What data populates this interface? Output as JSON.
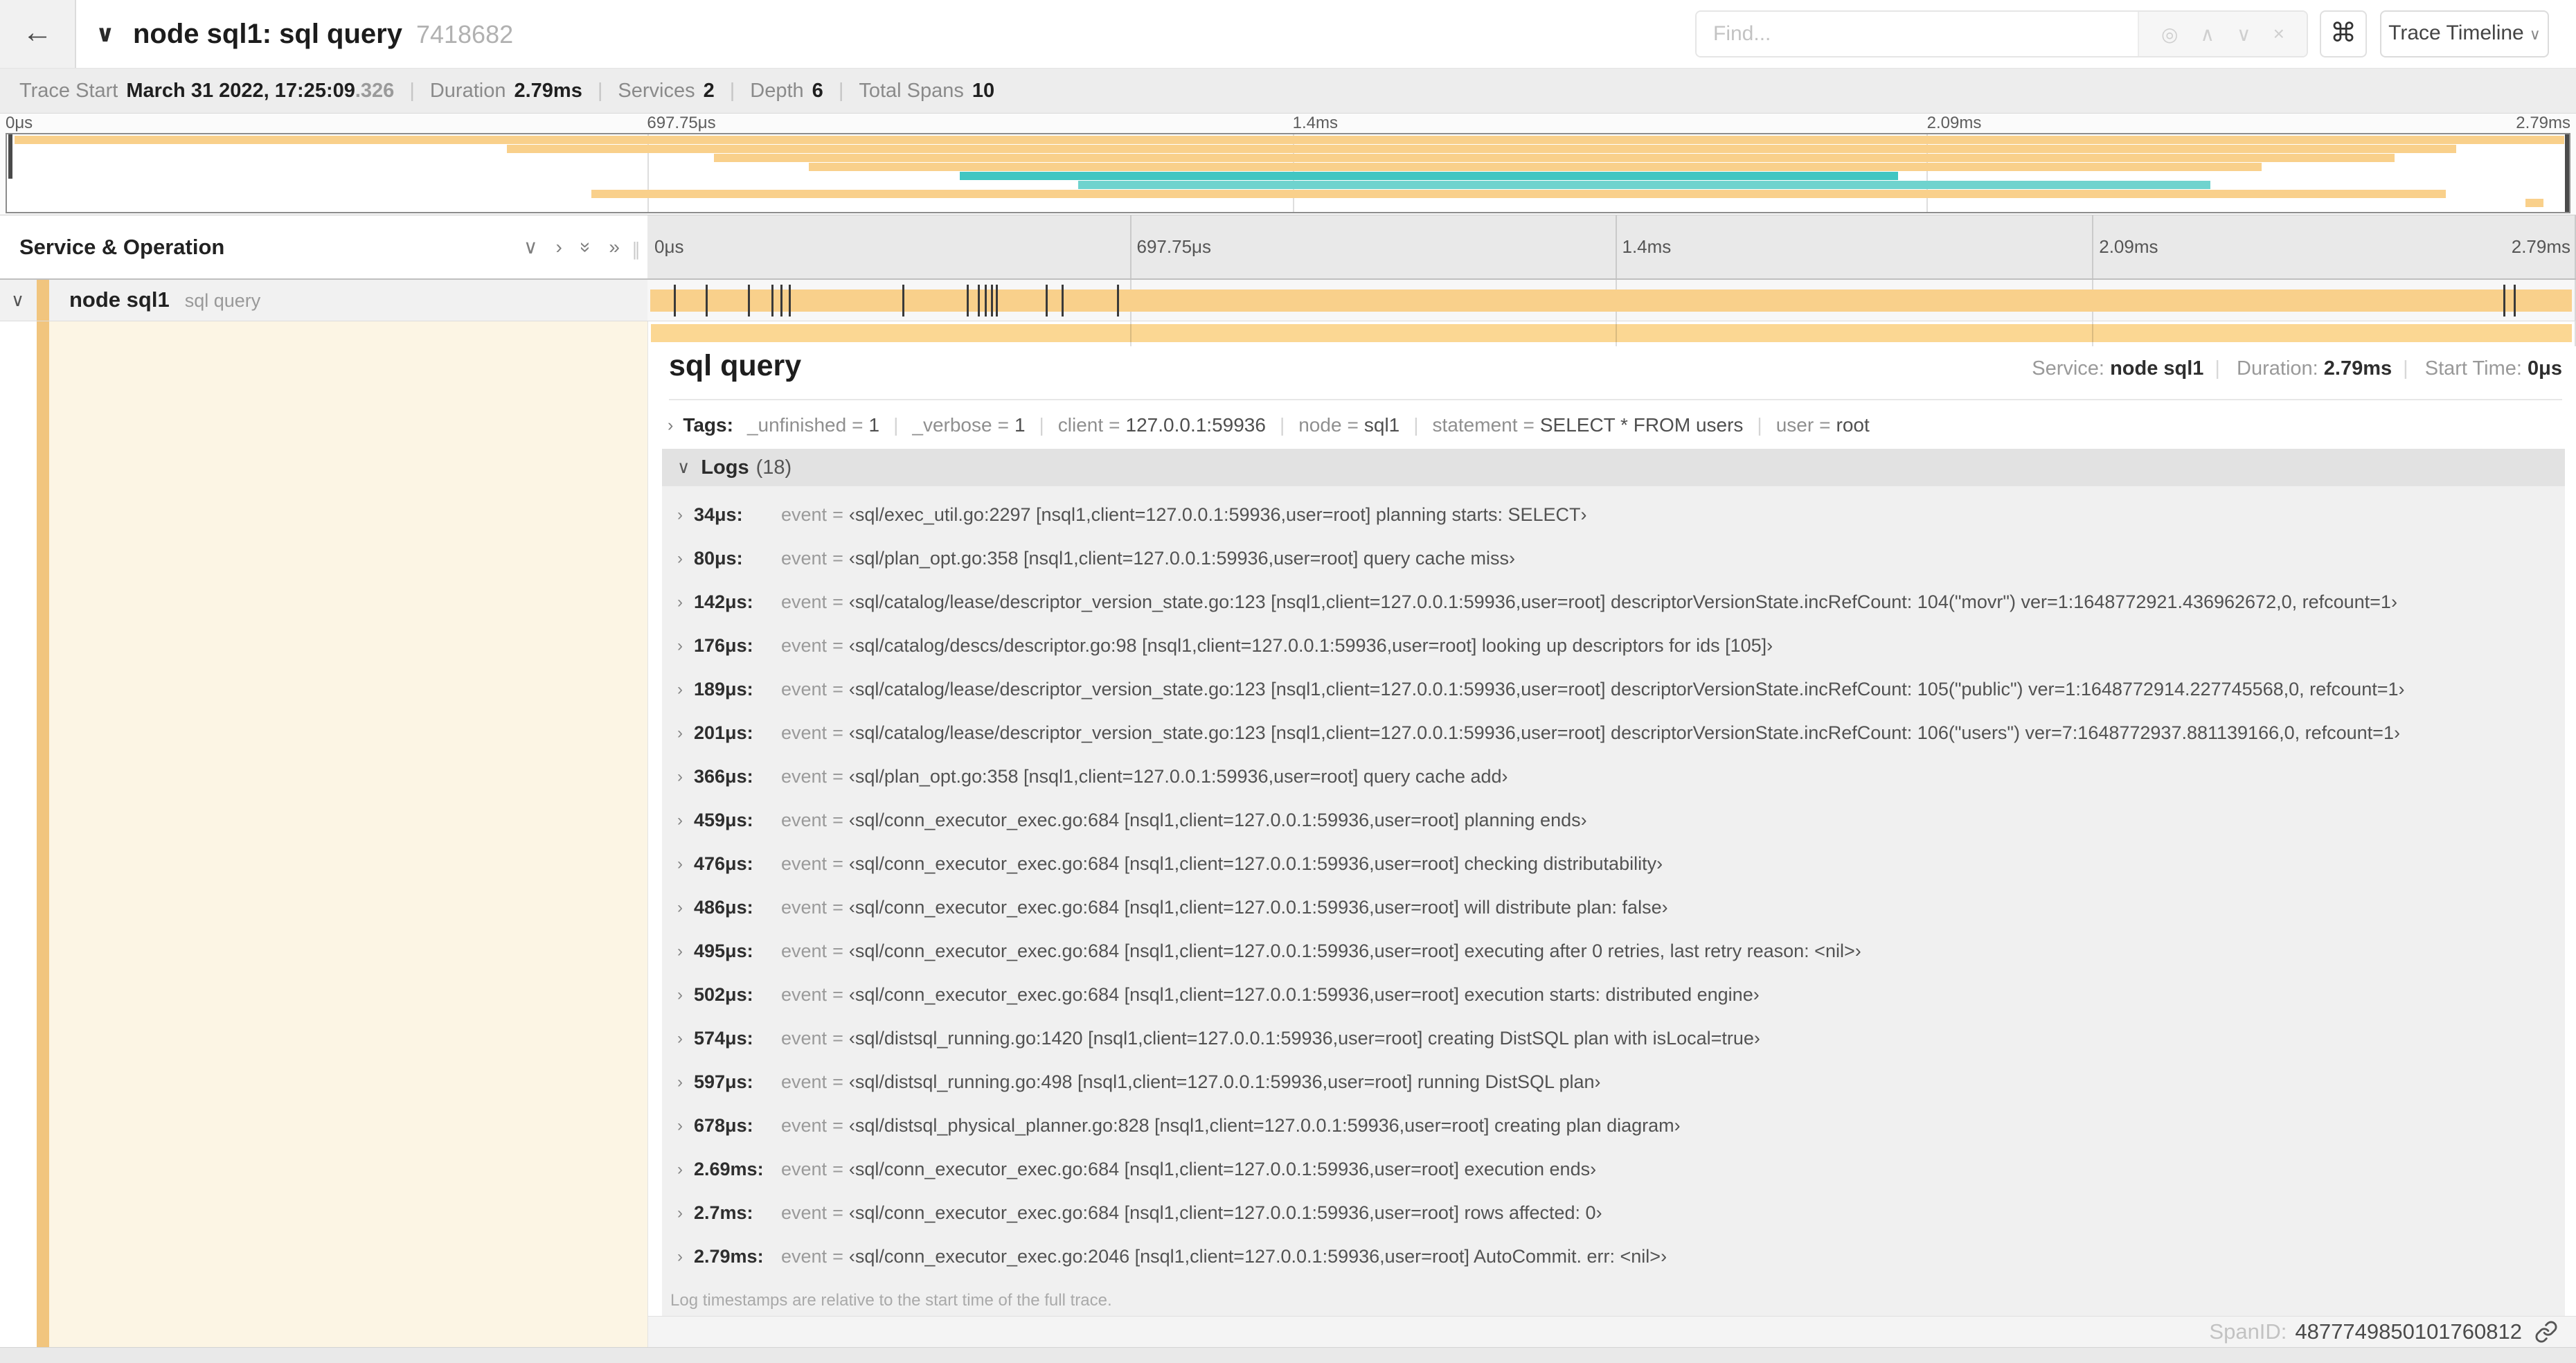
{
  "colors": {
    "tan": "#f9d08b",
    "tan_light": "#fbd793",
    "accent_strip": "#f1c57e",
    "detail_cream": "#fcf5e4",
    "teal": "#41c6c2",
    "teal_light": "#6fd3ce"
  },
  "header": {
    "back_icon": "←",
    "collapse_icon": "∨",
    "title": "node sql1: sql query",
    "trace_id": "7418682",
    "find_placeholder": "Find...",
    "locate_icon": "◎",
    "prev_icon": "∧",
    "next_icon": "∨",
    "clear_icon": "×",
    "command_icon": "⌘",
    "view_button_label": "Trace Timeline",
    "view_button_chevron": "∨"
  },
  "stats": [
    {
      "label": "Trace Start",
      "value": "March 31 2022, 17:25:09",
      "muted": ".326"
    },
    {
      "label": "Duration",
      "value": "2.79ms"
    },
    {
      "label": "Services",
      "value": "2"
    },
    {
      "label": "Depth",
      "value": "6"
    },
    {
      "label": "Total Spans",
      "value": "10"
    }
  ],
  "timeline": {
    "total_us": 2790,
    "axis_ticks": [
      {
        "label": "0μs",
        "pct": 0
      },
      {
        "label": "697.75μs",
        "pct": 25.01
      },
      {
        "label": "1.4ms",
        "pct": 50.18
      },
      {
        "label": "2.09ms",
        "pct": 74.91
      },
      {
        "label": "2.79ms",
        "pct": 100
      }
    ],
    "grid_pcts": [
      25.01,
      50.18,
      74.91,
      99.93
    ],
    "log_marks_us": [
      34,
      80,
      142,
      176,
      189,
      201,
      366,
      459,
      476,
      486,
      495,
      502,
      574,
      597,
      678,
      2690,
      2706
    ],
    "minimap_spans": [
      {
        "row": 0,
        "start": 0.3,
        "end": 99.8,
        "color": "tan"
      },
      {
        "row": 1,
        "start": 19.5,
        "end": 95.6,
        "color": "tan"
      },
      {
        "row": 2,
        "start": 27.6,
        "end": 93.2,
        "color": "tan"
      },
      {
        "row": 3,
        "start": 31.3,
        "end": 88.0,
        "color": "tan"
      },
      {
        "row": 4,
        "start": 37.2,
        "end": 73.8,
        "color": "teal"
      },
      {
        "row": 5,
        "start": 41.8,
        "end": 86.0,
        "color": "teal_light"
      },
      {
        "row": 6,
        "start": 22.8,
        "end": 95.2,
        "color": "tan"
      },
      {
        "row": 7,
        "start": 98.3,
        "end": 99.0,
        "color": "tan"
      }
    ]
  },
  "left_panel": {
    "title": "Service & Operation",
    "collapse_one_icon": "∨",
    "expand_one_icon": "›",
    "collapse_all_icon": "»",
    "expand_all_icon": "»",
    "resizer_icon": "∥",
    "row": {
      "chevron": "∨",
      "service": "node sql1",
      "operation": "sql query"
    }
  },
  "detail": {
    "title": "sql query",
    "meta": {
      "service_label": "Service:",
      "service": "node sql1",
      "duration_label": "Duration:",
      "duration": "2.79ms",
      "start_label": "Start Time:",
      "start": "0μs"
    },
    "tags_toggle": "›",
    "tags_label": "Tags:",
    "tags": [
      {
        "key": "_unfinished",
        "value": "1"
      },
      {
        "key": "_verbose",
        "value": "1"
      },
      {
        "key": "client",
        "value": "127.0.0.1:59936"
      },
      {
        "key": "node",
        "value": "sql1"
      },
      {
        "key": "statement",
        "value": "SELECT * FROM users"
      },
      {
        "key": "user",
        "value": "root"
      }
    ],
    "logs_toggle": "∨",
    "logs_label": "Logs",
    "logs_count": "(18)",
    "log_toggle": "›",
    "log_key": "event",
    "logs": [
      {
        "t": "34μs:",
        "value": "‹sql/exec_util.go:2297 [nsql1,client=127.0.0.1:59936,user=root] planning starts: SELECT›"
      },
      {
        "t": "80μs:",
        "value": "‹sql/plan_opt.go:358 [nsql1,client=127.0.0.1:59936,user=root] query cache miss›"
      },
      {
        "t": "142μs:",
        "value": "‹sql/catalog/lease/descriptor_version_state.go:123 [nsql1,client=127.0.0.1:59936,user=root] descriptorVersionState.incRefCount: 104(\"movr\") ver=1:1648772921.436962672,0, refcount=1›"
      },
      {
        "t": "176μs:",
        "value": "‹sql/catalog/descs/descriptor.go:98 [nsql1,client=127.0.0.1:59936,user=root] looking up descriptors for ids [105]›"
      },
      {
        "t": "189μs:",
        "value": "‹sql/catalog/lease/descriptor_version_state.go:123 [nsql1,client=127.0.0.1:59936,user=root] descriptorVersionState.incRefCount: 105(\"public\") ver=1:1648772914.227745568,0, refcount=1›"
      },
      {
        "t": "201μs:",
        "value": "‹sql/catalog/lease/descriptor_version_state.go:123 [nsql1,client=127.0.0.1:59936,user=root] descriptorVersionState.incRefCount: 106(\"users\") ver=7:1648772937.881139166,0, refcount=1›"
      },
      {
        "t": "366μs:",
        "value": "‹sql/plan_opt.go:358 [nsql1,client=127.0.0.1:59936,user=root] query cache add›"
      },
      {
        "t": "459μs:",
        "value": "‹sql/conn_executor_exec.go:684 [nsql1,client=127.0.0.1:59936,user=root] planning ends›"
      },
      {
        "t": "476μs:",
        "value": "‹sql/conn_executor_exec.go:684 [nsql1,client=127.0.0.1:59936,user=root] checking distributability›"
      },
      {
        "t": "486μs:",
        "value": "‹sql/conn_executor_exec.go:684 [nsql1,client=127.0.0.1:59936,user=root] will distribute plan: false›"
      },
      {
        "t": "495μs:",
        "value": "‹sql/conn_executor_exec.go:684 [nsql1,client=127.0.0.1:59936,user=root] executing after 0 retries, last retry reason: <nil>›"
      },
      {
        "t": "502μs:",
        "value": "‹sql/conn_executor_exec.go:684 [nsql1,client=127.0.0.1:59936,user=root] execution starts: distributed engine›"
      },
      {
        "t": "574μs:",
        "value": "‹sql/distsql_running.go:1420 [nsql1,client=127.0.0.1:59936,user=root] creating DistSQL plan with isLocal=true›"
      },
      {
        "t": "597μs:",
        "value": "‹sql/distsql_running.go:498 [nsql1,client=127.0.0.1:59936,user=root] running DistSQL plan›"
      },
      {
        "t": "678μs:",
        "value": "‹sql/distsql_physical_planner.go:828 [nsql1,client=127.0.0.1:59936,user=root] creating plan diagram›"
      },
      {
        "t": "2.69ms:",
        "value": "‹sql/conn_executor_exec.go:684 [nsql1,client=127.0.0.1:59936,user=root] execution ends›"
      },
      {
        "t": "2.7ms:",
        "value": "‹sql/conn_executor_exec.go:684 [nsql1,client=127.0.0.1:59936,user=root] rows affected: 0›"
      },
      {
        "t": "2.79ms:",
        "value": "‹sql/conn_executor_exec.go:2046 [nsql1,client=127.0.0.1:59936,user=root] AutoCommit. err: <nil>›"
      }
    ],
    "logs_note": "Log timestamps are relative to the start time of the full trace.",
    "spanid_label": "SpanID:",
    "spanid": "4877749850101760812"
  }
}
